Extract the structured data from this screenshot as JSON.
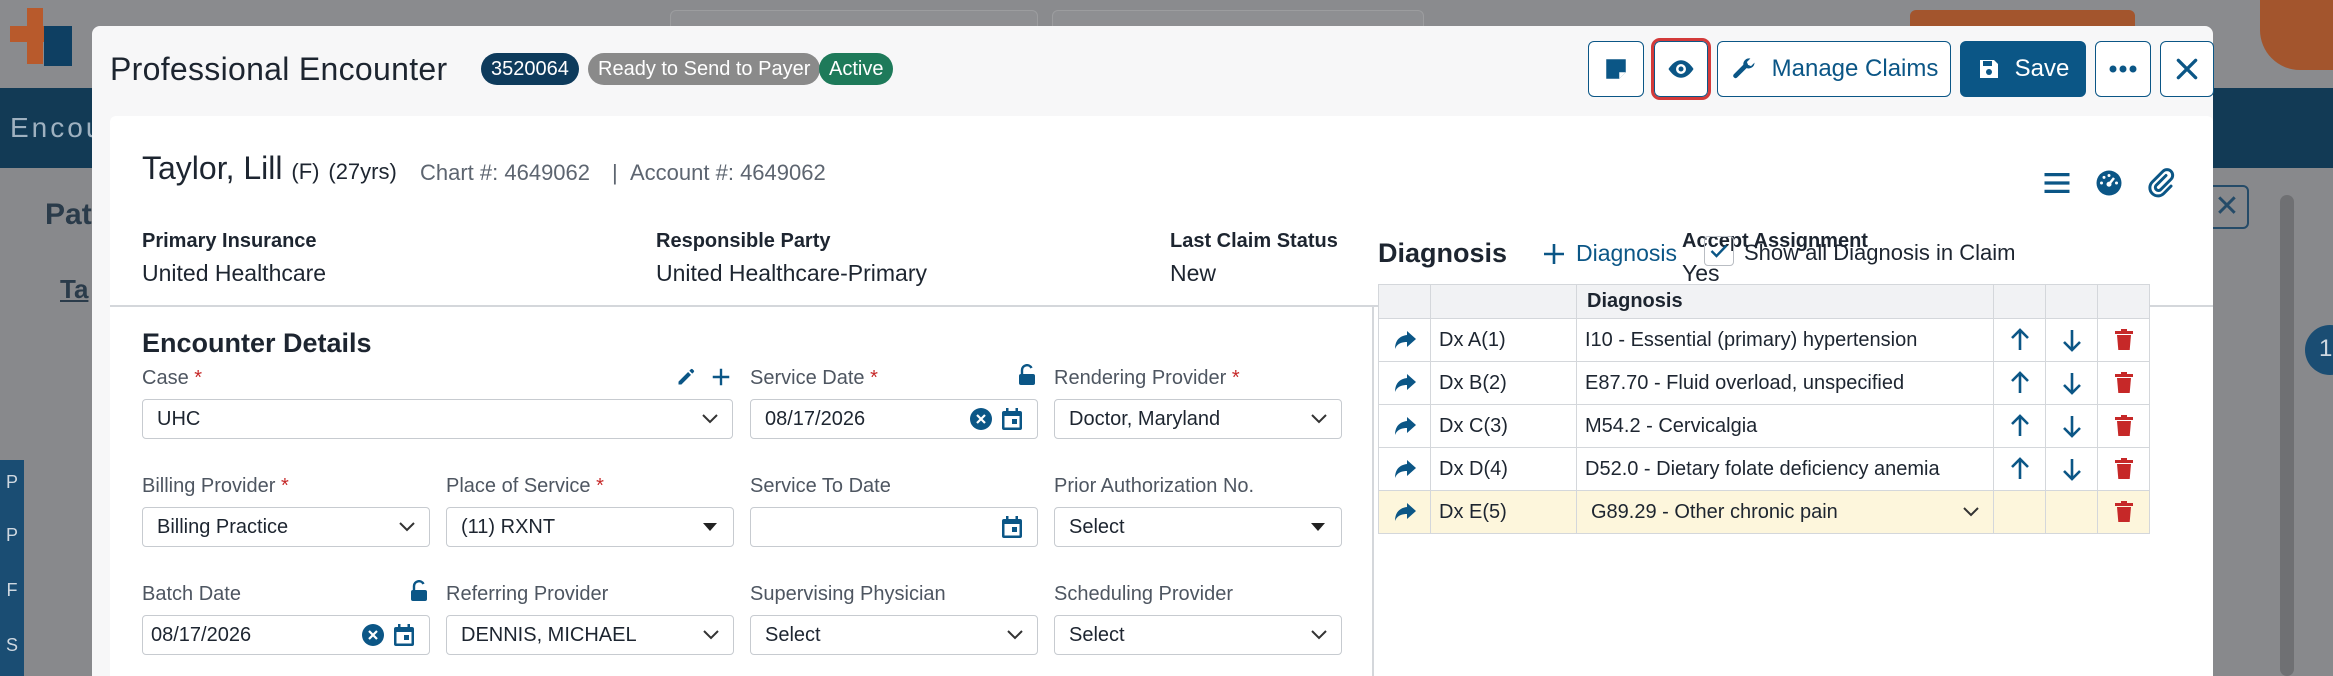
{
  "background": {
    "nav_text": "Encou",
    "left_title": "Pat",
    "left_sub": "Ta",
    "left_letters": [
      "P",
      "P",
      "F",
      "S"
    ],
    "right_badge": "1"
  },
  "header": {
    "title": "Professional Encounter",
    "encounter_id": "3520064",
    "status_badge": "Ready to Send to Payer",
    "active_badge": "Active",
    "manage_claims_label": "Manage Claims",
    "save_label": "Save"
  },
  "patient": {
    "name": "Taylor, Lill",
    "sex": "(F)",
    "age": "(27yrs)",
    "chart": "Chart #: 4649062",
    "separator": "|",
    "account": "Account #: 4649062"
  },
  "summary": [
    {
      "label": "Primary Insurance",
      "value": "United Healthcare"
    },
    {
      "label": "Responsible Party",
      "value": "United Healthcare-Primary"
    },
    {
      "label": "Last Claim Status",
      "value": "New"
    },
    {
      "label": "Accept Assignment",
      "value": "Yes"
    }
  ],
  "encounter": {
    "section_title": "Encounter Details",
    "case_label": "Case",
    "case_value": "UHC",
    "service_date_label": "Service Date",
    "service_date_value": "08/17/2026",
    "rendering_provider_label": "Rendering Provider",
    "rendering_provider_value": "Doctor, Maryland",
    "billing_provider_label": "Billing Provider",
    "billing_provider_value": "Billing Practice",
    "place_of_service_label": "Place of Service",
    "place_of_service_value": "(11) RXNT",
    "service_to_date_label": "Service To Date",
    "service_to_date_value": "",
    "prior_auth_label": "Prior Authorization No.",
    "prior_auth_value": "Select",
    "batch_date_label": "Batch Date",
    "batch_date_value": "08/17/2026",
    "referring_provider_label": "Referring Provider",
    "referring_provider_value": "DENNIS, MICHAEL",
    "supervising_label": "Supervising Physician",
    "supervising_value": "Select",
    "scheduling_label": "Scheduling Provider",
    "scheduling_value": "Select",
    "required_mark": "*"
  },
  "diagnosis": {
    "title": "Diagnosis",
    "add_label": "Diagnosis",
    "show_all_label": "Show all Diagnosis in Claim",
    "column_header": "Diagnosis",
    "rows": [
      {
        "dx": "Dx A(1)",
        "desc": "I10 - Essential (primary) hypertension"
      },
      {
        "dx": "Dx B(2)",
        "desc": "E87.70 - Fluid overload, unspecified"
      },
      {
        "dx": "Dx C(3)",
        "desc": "M54.2 - Cervicalgia"
      },
      {
        "dx": "Dx D(4)",
        "desc": "D52.0 - Dietary folate deficiency anemia"
      },
      {
        "dx": "Dx E(5)",
        "desc": "G89.29 - Other chronic pain"
      }
    ]
  },
  "colors": {
    "primary": "#0b5686",
    "id_badge": "#0e3b5c",
    "status_badge": "#8a8a8a",
    "active_badge": "#1e7a5a",
    "danger": "#c62828",
    "highlight_row": "#fdf6dc"
  }
}
